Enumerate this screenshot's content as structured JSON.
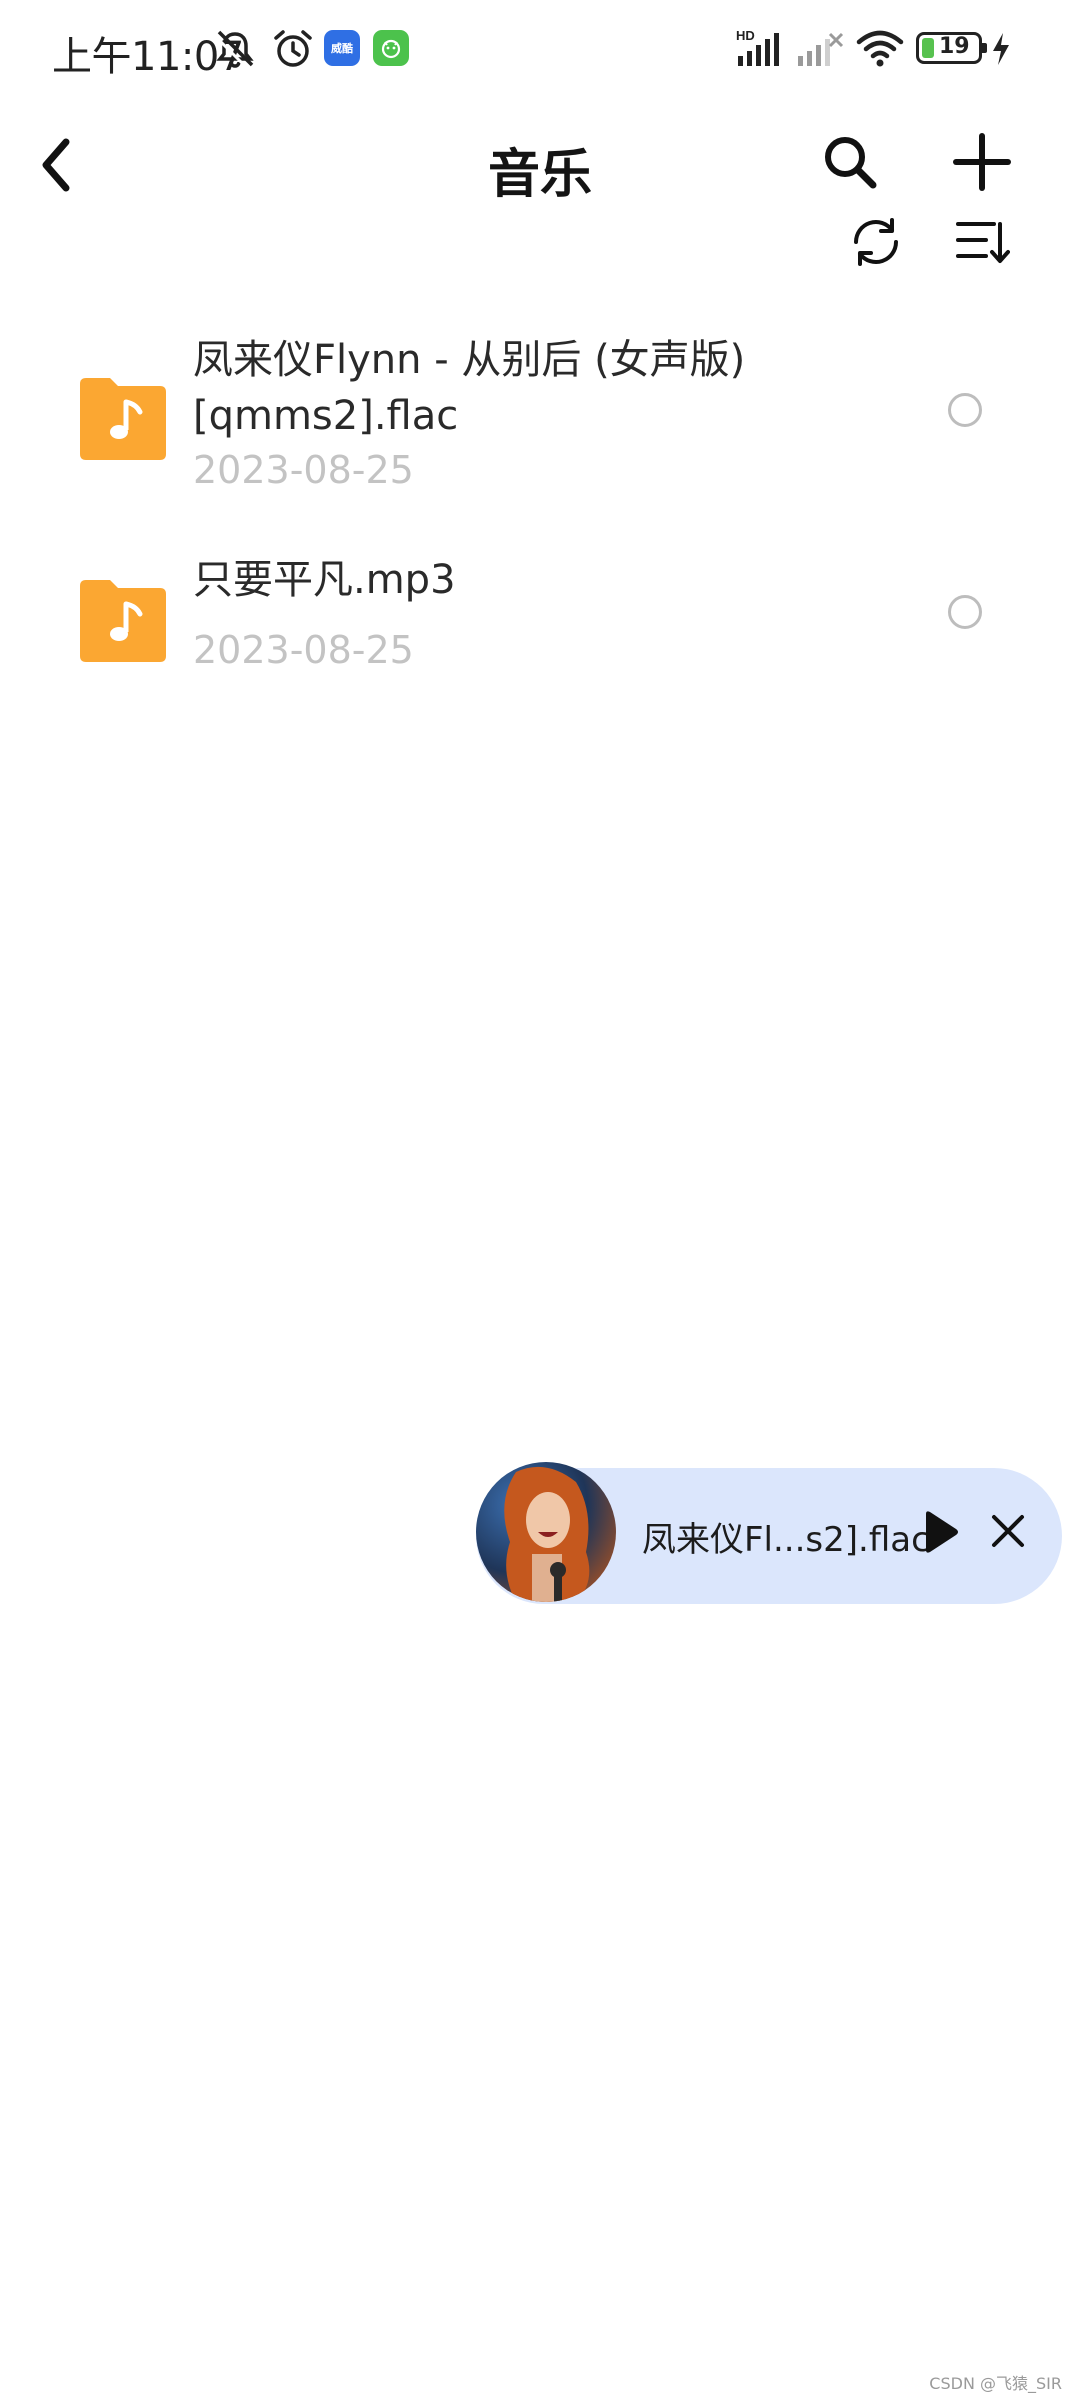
{
  "status_bar": {
    "time": "上午11:07",
    "app_badge_1": "威酷",
    "battery_level": "19",
    "icons": [
      "mute-bell-icon",
      "alarm-icon",
      "signal-hd-icon",
      "signal-no-service-icon",
      "wifi-icon",
      "battery-icon",
      "charging-icon"
    ]
  },
  "header": {
    "title": "音乐",
    "icons": [
      "back-icon",
      "search-icon",
      "add-icon",
      "refresh-icon",
      "sort-icon"
    ]
  },
  "files": [
    {
      "name": "凤来仪Flynn - 从别后 (女声版)[qmms2].flac",
      "date": "2023-08-25"
    },
    {
      "name": "只要平凡.mp3",
      "date": "2023-08-25"
    }
  ],
  "player": {
    "title": "凤来仪Fl...s2].flac",
    "icons": [
      "play-icon",
      "close-icon"
    ]
  },
  "watermark": "CSDN @飞猿_SIR",
  "colors": {
    "accent_folder": "#FBA732",
    "player_bg": "#DBE6FC",
    "date_gray": "#C3C3C3",
    "status_green_badge": "#4CC24C",
    "status_blue_badge": "#2F6FE4"
  }
}
